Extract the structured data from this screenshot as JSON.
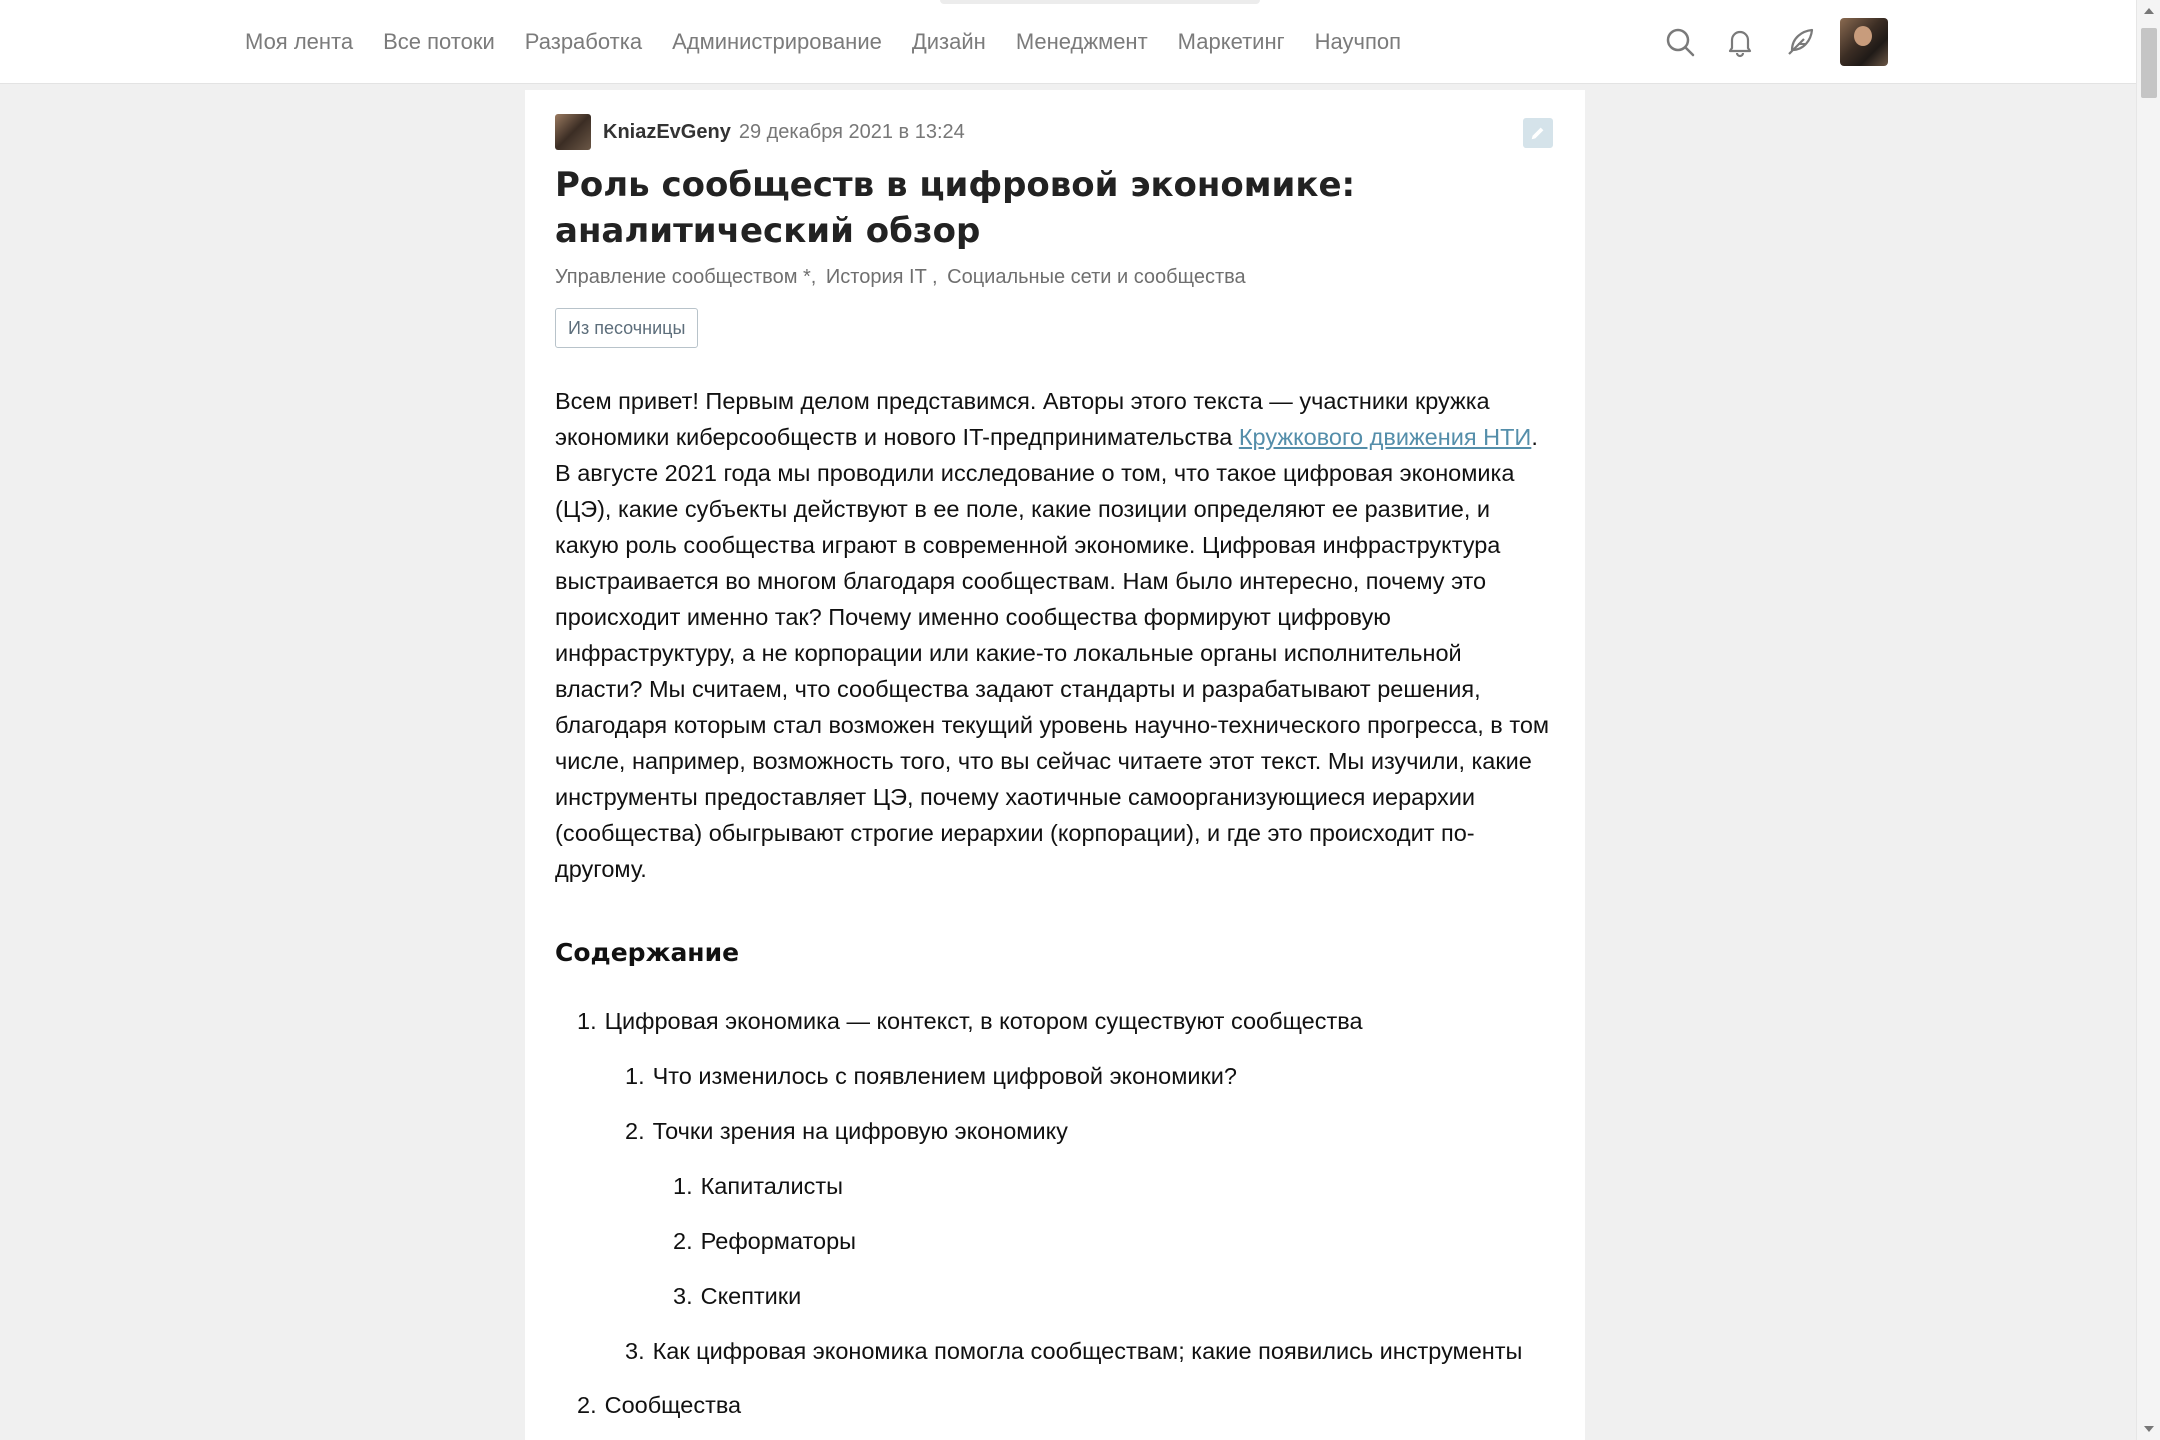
{
  "nav": {
    "items": [
      "Моя лента",
      "Все потоки",
      "Разработка",
      "Администрирование",
      "Дизайн",
      "Менеджмент",
      "Маркетинг",
      "Научпоп"
    ]
  },
  "tools": {
    "search_icon": "search-icon",
    "bell_icon": "bell-icon",
    "write_icon": "feather-icon"
  },
  "article": {
    "author": "KniazEvGeny",
    "date": "29 декабря 2021 в 13:24",
    "title": "Роль сообществ в цифровой экономике: аналитический обзор",
    "hubs": [
      "Управление сообществом *,",
      "История IT ,",
      "Социальные сети и сообщества"
    ],
    "badge": "Из песочницы",
    "intro_before_link": "Всем привет! Первым делом представимся. Авторы этого текста — участники кружка экономики киберсообществ и нового IT-предпринимательства ",
    "intro_link": "Кружкового движения НТИ",
    "intro_after_link": ". В августе 2021 года мы проводили исследование о том, что такое цифровая экономика (ЦЭ), какие субъекты действуют в ее поле, какие позиции определяют ее развитие, и какую роль сообщества играют в современной экономике. Цифровая инфраструктура выстраивается во многом благодаря сообществам. Нам было интересно, почему это происходит именно так? Почему именно сообщества формируют цифровую инфраструктуру, а не корпорации или какие-то локальные органы исполнительной власти? Мы считаем, что сообщества задают стандарты и разрабатывают решения, благодаря которым стал возможен текущий уровень научно-технического прогресса, в том числе, например, возможность того, что вы сейчас читаете этот текст. Мы изучили, какие инструменты предоставляет ЦЭ, почему хаотичные самоорганизующиеся иерархии (сообщества) обыгрывают строгие иерархии (корпорации), и где это происходит по-другому.",
    "toc_title": "Содержание",
    "toc": [
      {
        "num": "1.",
        "text": "Цифровая экономика — контекст, в котором существуют сообщества"
      },
      {
        "num": "1.",
        "text": "Что изменилось с появлением цифровой экономики?"
      },
      {
        "num": "2.",
        "text": "Точки зрения на цифровую экономику"
      },
      {
        "num": "1.",
        "text": "Капиталисты"
      },
      {
        "num": "2.",
        "text": "Реформаторы"
      },
      {
        "num": "3.",
        "text": "Скептики"
      },
      {
        "num": "3.",
        "text": "Как цифровая экономика помогла сообществам; какие появились инструменты"
      },
      {
        "num": "2.",
        "text": "Сообщества"
      }
    ]
  }
}
